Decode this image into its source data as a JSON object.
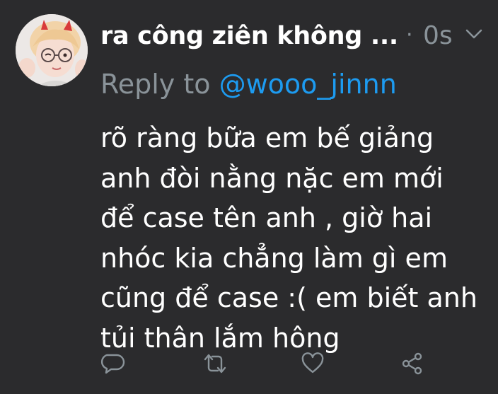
{
  "tweet": {
    "display_name": "ra công ziên không ...",
    "dot": "·",
    "timestamp": "0s",
    "reply_label": "Reply to",
    "reply_handle": "@wooo_jinnn",
    "text": "rõ ràng bữa em bế giảng\nanh đòi nằng nặc em mới\nđể case tên anh , giờ hai\nnhóc kia chẳng làm gì em\ncũng để case :( em biết anh\ntủi thân lắm  hông"
  },
  "icons": {
    "more": "chevron-down-icon",
    "reply": "speech-bubble-icon",
    "retweet": "retweet-icon",
    "like": "heart-icon",
    "share": "share-icon"
  },
  "colors": {
    "background": "#2b2b2d",
    "muted": "#8a9399",
    "link": "#1d9bf0",
    "text": "#ffffff"
  }
}
